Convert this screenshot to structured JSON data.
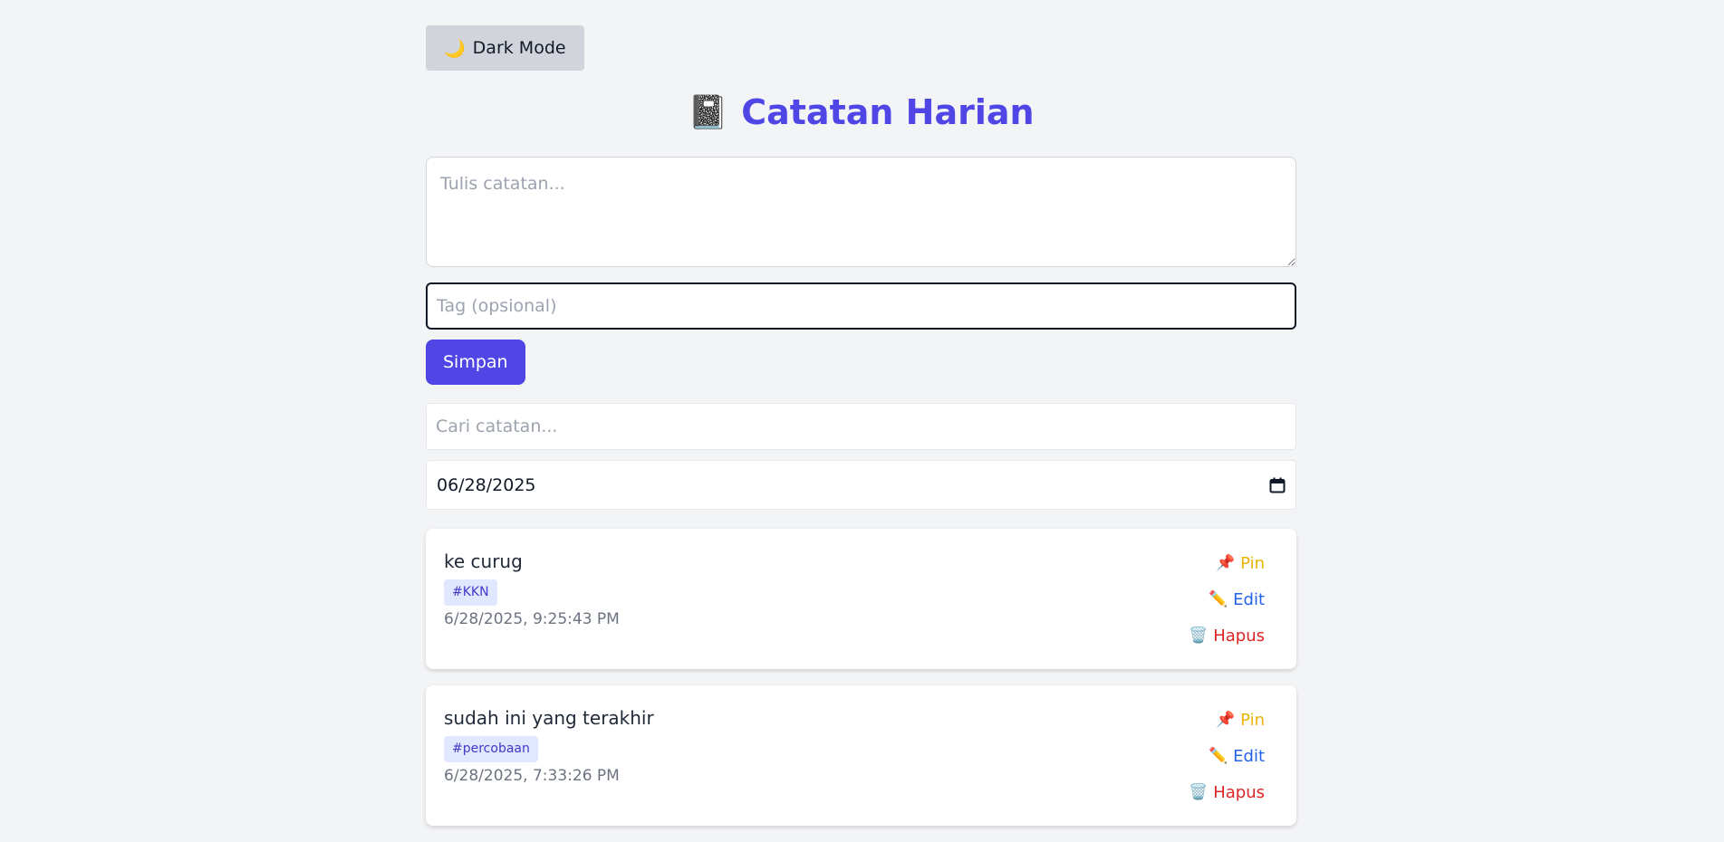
{
  "header": {
    "dark_mode_icon": "🌙",
    "dark_mode_label": "Dark Mode",
    "title_icon": "📓",
    "title": "Catatan Harian"
  },
  "form": {
    "note_placeholder": "Tulis catatan...",
    "tag_placeholder": "Tag (opsional)",
    "save_label": "Simpan"
  },
  "filters": {
    "search_placeholder": "Cari catatan...",
    "date_value": "06/28/2025"
  },
  "actions": {
    "pin_icon": "📌",
    "pin_label": "Pin",
    "edit_icon": "✏️",
    "edit_label": "Edit",
    "delete_icon": "🗑️",
    "delete_label": "Hapus"
  },
  "notes": [
    {
      "text": "ke curug",
      "tag": "#KKN",
      "date": "6/28/2025, 9:25:43 PM"
    },
    {
      "text": "sudah ini yang terakhir",
      "tag": "#percobaan",
      "date": "6/28/2025, 7:33:26 PM"
    }
  ],
  "colors": {
    "accent": "#4f46e5",
    "background": "#f3f4f6",
    "pin": "#eab308",
    "edit": "#2563eb",
    "delete": "#dc2626"
  }
}
